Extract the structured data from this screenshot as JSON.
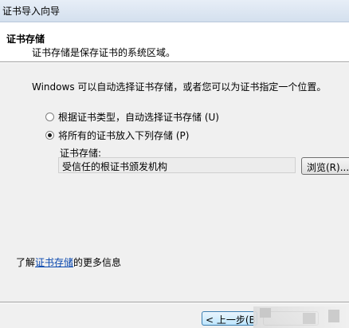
{
  "window": {
    "title": "证书导入向导"
  },
  "header": {
    "title": "证书存储",
    "description": "证书存储是保存证书的系统区域。"
  },
  "body": {
    "intro": "Windows 可以自动选择证书存储，或者您可以为证书指定一个位置。",
    "options": [
      {
        "label": "根据证书类型，自动选择证书存储 (U)",
        "checked": false
      },
      {
        "label": "将所有的证书放入下列存储 (P)",
        "checked": true
      }
    ],
    "store_label": "证书存储:",
    "store_value": "受信任的根证书颁发机构",
    "browse_label": "浏览(R)...",
    "learn_prefix": "了解",
    "learn_link": "证书存储",
    "learn_suffix": "的更多信息"
  },
  "footer": {
    "back_label": "< 上一步(B)"
  }
}
